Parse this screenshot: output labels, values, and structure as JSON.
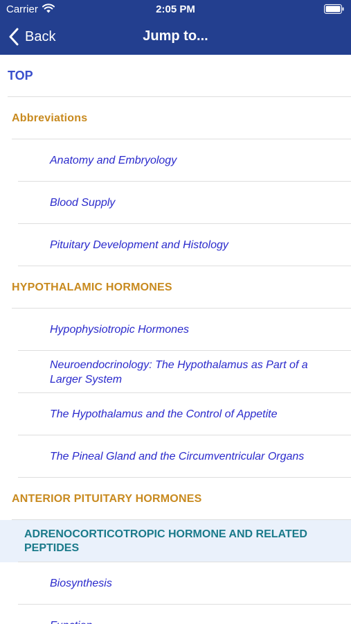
{
  "status_bar": {
    "carrier": "Carrier",
    "time": "2:05 PM"
  },
  "nav": {
    "back_label": "Back",
    "title": "Jump to..."
  },
  "items": [
    {
      "label": "TOP",
      "level": 0
    },
    {
      "label": "Abbreviations",
      "level": 1
    },
    {
      "label": "Anatomy and Embryology",
      "level": 2
    },
    {
      "label": "Blood Supply",
      "level": 2
    },
    {
      "label": "Pituitary Development and Histology",
      "level": 2
    },
    {
      "label": "HYPOTHALAMIC HORMONES",
      "level": 1
    },
    {
      "label": "Hypophysiotropic Hormones",
      "level": 2
    },
    {
      "label": "Neuroendocrinology: The Hypothalamus as Part of a Larger System",
      "level": 2
    },
    {
      "label": "The Hypothalamus and the Control of Appetite",
      "level": 2
    },
    {
      "label": "The Pineal Gland and the Circumventricular Organs",
      "level": 2
    },
    {
      "label": "ANTERIOR PITUITARY HORMONES",
      "level": 1
    },
    {
      "label": "ADRENOCORTICOTROPIC HORMONE AND RELATED PEPTIDES",
      "level": 1,
      "highlighted": true
    },
    {
      "label": "Biosynthesis",
      "level": 2
    },
    {
      "label": "Function",
      "level": 2
    }
  ],
  "colors": {
    "header_bg": "#233f8f",
    "top_item": "#3a4fcc",
    "section_item": "#c88a1f",
    "sub_item": "#2a2acc",
    "highlight_bg": "#eaf1fb",
    "highlight_text": "#1a7a8a"
  }
}
